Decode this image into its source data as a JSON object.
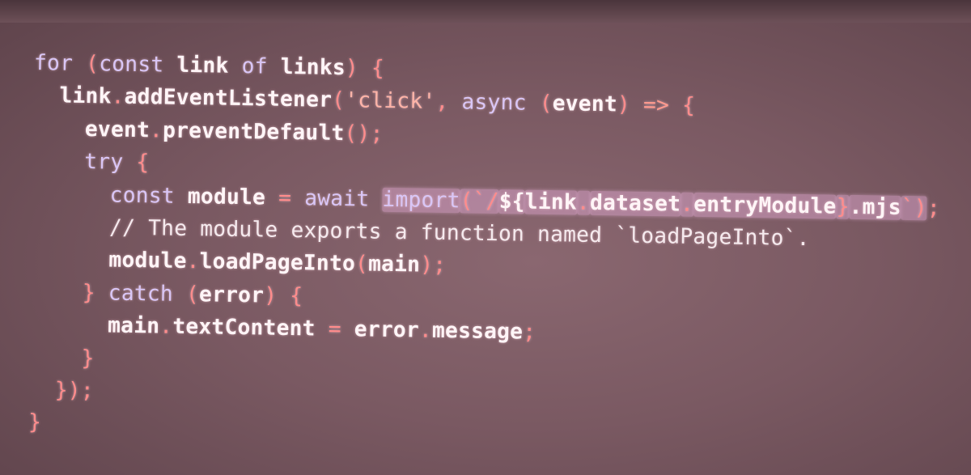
{
  "code_lines": [
    [
      {
        "t": "for",
        "c": "kw"
      },
      {
        "t": " ",
        "c": ""
      },
      {
        "t": "(",
        "c": "pu"
      },
      {
        "t": "const",
        "c": "kw"
      },
      {
        "t": " ",
        "c": ""
      },
      {
        "t": "link",
        "c": "b"
      },
      {
        "t": " ",
        "c": ""
      },
      {
        "t": "of",
        "c": "kw"
      },
      {
        "t": " ",
        "c": ""
      },
      {
        "t": "links",
        "c": "b"
      },
      {
        "t": ")",
        "c": "pu"
      },
      {
        "t": " ",
        "c": ""
      },
      {
        "t": "{",
        "c": "pu"
      }
    ],
    [
      {
        "t": "  ",
        "c": ""
      },
      {
        "t": "link",
        "c": "b"
      },
      {
        "t": ".",
        "c": "pu"
      },
      {
        "t": "addEventListener",
        "c": "b"
      },
      {
        "t": "(",
        "c": "pu"
      },
      {
        "t": "'click'",
        "c": "str"
      },
      {
        "t": ",",
        "c": "pu"
      },
      {
        "t": " ",
        "c": ""
      },
      {
        "t": "async",
        "c": "kw"
      },
      {
        "t": " ",
        "c": ""
      },
      {
        "t": "(",
        "c": "pu"
      },
      {
        "t": "event",
        "c": "b"
      },
      {
        "t": ")",
        "c": "pu"
      },
      {
        "t": " ",
        "c": ""
      },
      {
        "t": "=>",
        "c": "ar"
      },
      {
        "t": " ",
        "c": ""
      },
      {
        "t": "{",
        "c": "pu"
      }
    ],
    [
      {
        "t": "    ",
        "c": ""
      },
      {
        "t": "event",
        "c": "b"
      },
      {
        "t": ".",
        "c": "pu"
      },
      {
        "t": "preventDefault",
        "c": "b"
      },
      {
        "t": "();",
        "c": "pu"
      }
    ],
    [
      {
        "t": "    ",
        "c": ""
      },
      {
        "t": "try",
        "c": "kw"
      },
      {
        "t": " ",
        "c": ""
      },
      {
        "t": "{",
        "c": "pu"
      }
    ],
    [
      {
        "t": "      ",
        "c": ""
      },
      {
        "t": "const",
        "c": "kw"
      },
      {
        "t": " ",
        "c": ""
      },
      {
        "t": "module",
        "c": "b"
      },
      {
        "t": " ",
        "c": ""
      },
      {
        "t": "=",
        "c": "pu"
      },
      {
        "t": " ",
        "c": ""
      },
      {
        "t": "await",
        "c": "kw"
      },
      {
        "t": " ",
        "c": ""
      },
      {
        "t": "import",
        "c": "kw hl"
      },
      {
        "t": "(`/",
        "c": "pu hl"
      },
      {
        "t": "${",
        "c": "b hl"
      },
      {
        "t": "link",
        "c": "b hl"
      },
      {
        "t": ".",
        "c": "pu hl"
      },
      {
        "t": "dataset",
        "c": "b hl"
      },
      {
        "t": ".",
        "c": "pu hl"
      },
      {
        "t": "entryModule",
        "c": "b hl"
      },
      {
        "t": "}",
        "c": "pu hl"
      },
      {
        "t": ".mjs",
        "c": "b hl"
      },
      {
        "t": "`)",
        "c": "pu hl"
      },
      {
        "t": ";",
        "c": "pu"
      }
    ],
    [
      {
        "t": "      ",
        "c": ""
      },
      {
        "t": "// The module exports a function named `loadPageInto`.",
        "c": "cm"
      }
    ],
    [
      {
        "t": "      ",
        "c": ""
      },
      {
        "t": "module",
        "c": "b"
      },
      {
        "t": ".",
        "c": "pu"
      },
      {
        "t": "loadPageInto",
        "c": "b"
      },
      {
        "t": "(",
        "c": "pu"
      },
      {
        "t": "main",
        "c": "b"
      },
      {
        "t": ");",
        "c": "pu"
      }
    ],
    [
      {
        "t": "    ",
        "c": ""
      },
      {
        "t": "}",
        "c": "pu"
      },
      {
        "t": " ",
        "c": ""
      },
      {
        "t": "catch",
        "c": "kw"
      },
      {
        "t": " ",
        "c": ""
      },
      {
        "t": "(",
        "c": "pu"
      },
      {
        "t": "error",
        "c": "b"
      },
      {
        "t": ")",
        "c": "pu"
      },
      {
        "t": " ",
        "c": ""
      },
      {
        "t": "{",
        "c": "pu"
      }
    ],
    [
      {
        "t": "      ",
        "c": ""
      },
      {
        "t": "main",
        "c": "b"
      },
      {
        "t": ".",
        "c": "pu"
      },
      {
        "t": "textContent",
        "c": "b"
      },
      {
        "t": " ",
        "c": ""
      },
      {
        "t": "=",
        "c": "pu"
      },
      {
        "t": " ",
        "c": ""
      },
      {
        "t": "error",
        "c": "b"
      },
      {
        "t": ".",
        "c": "pu"
      },
      {
        "t": "message",
        "c": "b"
      },
      {
        "t": ";",
        "c": "pu"
      }
    ],
    [
      {
        "t": "    ",
        "c": ""
      },
      {
        "t": "}",
        "c": "pu"
      }
    ],
    [
      {
        "t": "  ",
        "c": ""
      },
      {
        "t": "});",
        "c": "pu"
      }
    ],
    [
      {
        "t": "}",
        "c": "pu"
      }
    ]
  ],
  "colors": {
    "background": "#7a5962",
    "keyword": "#d9c6f6",
    "punctuation": "#ff8c8c",
    "string": "#ffb4a8",
    "identifier": "#fff5f7",
    "highlight": "#d6a0c4"
  }
}
